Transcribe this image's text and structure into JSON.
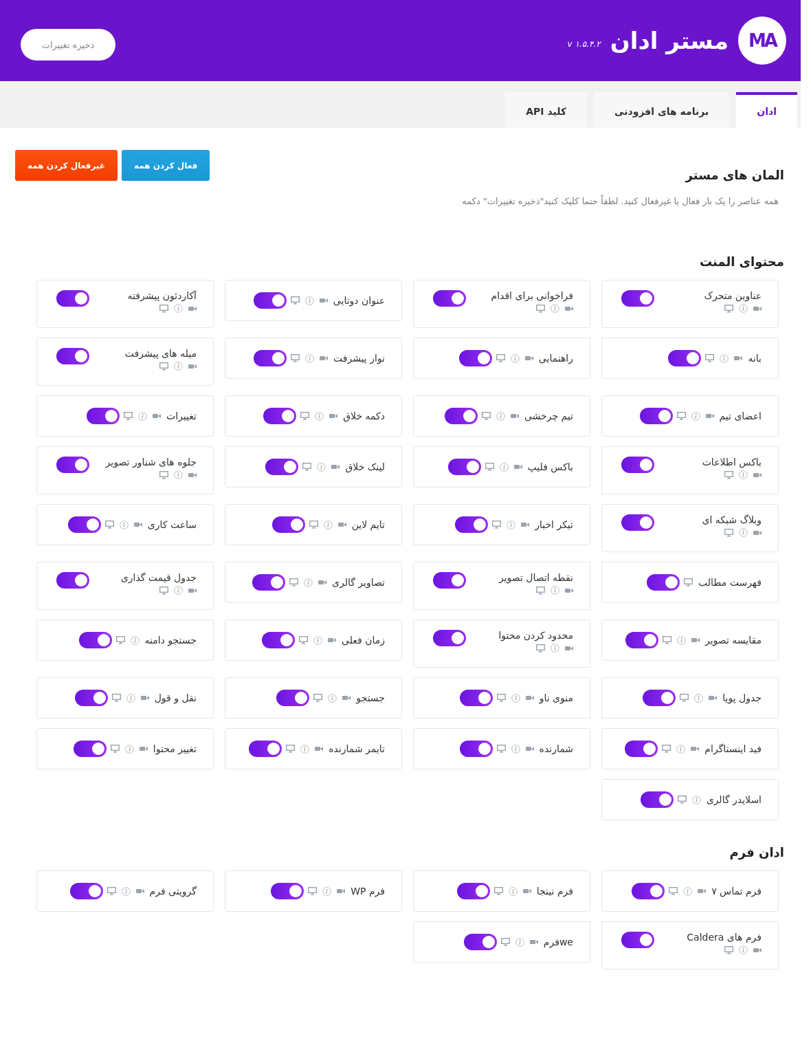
{
  "header": {
    "logo": "MA",
    "title": "مستر ادان",
    "version": "v ۱.۵.۴.۲",
    "save_button": "ذخیره تغییرات"
  },
  "tabs": [
    {
      "label": "ادان",
      "selected": true
    },
    {
      "label": "برنامه های افزودنی",
      "selected": false
    },
    {
      "label": "کلید API",
      "selected": false
    }
  ],
  "intro": {
    "title": "المان های مستر",
    "description": "همه عناصر را یک بار فعال یا غیرفعال کنید. لطفاً حتما کلیک کنید\"ذخیره تغییرات\" دکمه",
    "enable_all": "فعال کردن همه",
    "disable_all": "غیرفعال کردن همه"
  },
  "sections": [
    {
      "title": "محتوای المنت",
      "items": [
        {
          "name": "عناوین متحرک",
          "kind": "stacked",
          "video": true,
          "info": true,
          "desktop": true,
          "on": true
        },
        {
          "name": "فراخوانی برای اقدام",
          "kind": "stacked",
          "video": true,
          "info": true,
          "desktop": true,
          "on": true
        },
        {
          "name": "عنوان دوتایی",
          "kind": "inline",
          "video": true,
          "info": true,
          "desktop": true,
          "on": true
        },
        {
          "name": "آکاردئون پیشرفته",
          "kind": "stacked",
          "video": true,
          "info": true,
          "desktop": true,
          "on": true
        },
        {
          "name": "بانه",
          "kind": "inline",
          "video": true,
          "info": true,
          "desktop": true,
          "on": true
        },
        {
          "name": "راهنمایی",
          "kind": "inline",
          "video": true,
          "info": true,
          "desktop": true,
          "on": true
        },
        {
          "name": "نوار پیشرفت",
          "kind": "inline",
          "video": true,
          "info": true,
          "desktop": true,
          "on": true
        },
        {
          "name": "میله های پیشرفت",
          "kind": "stacked",
          "video": true,
          "info": true,
          "desktop": true,
          "on": true
        },
        {
          "name": "اعضای تیم",
          "kind": "inline",
          "video": true,
          "info": true,
          "desktop": true,
          "on": true
        },
        {
          "name": "تیم چرخشی",
          "kind": "inline",
          "video": true,
          "info": true,
          "desktop": true,
          "on": true
        },
        {
          "name": "دکمه خلاق",
          "kind": "inline",
          "video": true,
          "info": true,
          "desktop": true,
          "on": true
        },
        {
          "name": "تغییرات",
          "kind": "inline",
          "video": true,
          "info": true,
          "desktop": true,
          "on": true
        },
        {
          "name": "باکس اطلاعات",
          "kind": "stacked",
          "video": true,
          "info": true,
          "desktop": true,
          "on": true
        },
        {
          "name": "باکس فلیپ",
          "kind": "inline",
          "video": true,
          "info": true,
          "desktop": true,
          "on": true
        },
        {
          "name": "لینک خلاق",
          "kind": "inline",
          "video": true,
          "info": true,
          "desktop": true,
          "on": true
        },
        {
          "name": "جلوه های شناور تصویر",
          "kind": "stacked",
          "video": true,
          "info": true,
          "desktop": true,
          "on": true
        },
        {
          "name": "وبلاگ شبکه ای",
          "kind": "stacked",
          "video": true,
          "info": true,
          "desktop": true,
          "on": true
        },
        {
          "name": "تیکر اخبار",
          "kind": "inline",
          "video": true,
          "info": true,
          "desktop": true,
          "on": true
        },
        {
          "name": "تایم لاین",
          "kind": "inline",
          "video": true,
          "info": true,
          "desktop": true,
          "on": true
        },
        {
          "name": "ساعت کاری",
          "kind": "inline",
          "video": true,
          "info": true,
          "desktop": true,
          "on": true
        },
        {
          "name": "فهرست مطالب",
          "kind": "inline",
          "video": false,
          "info": false,
          "desktop": true,
          "on": true
        },
        {
          "name": "نقطه اتصال تصویر",
          "kind": "stacked",
          "video": true,
          "info": true,
          "desktop": true,
          "on": true
        },
        {
          "name": "تصاویر گالری",
          "kind": "inline",
          "video": true,
          "info": true,
          "desktop": true,
          "on": true
        },
        {
          "name": "جدول قیمت گذاری",
          "kind": "stacked",
          "video": true,
          "info": true,
          "desktop": true,
          "on": true
        },
        {
          "name": "مقایسه تصویر",
          "kind": "inline",
          "video": true,
          "info": true,
          "desktop": true,
          "on": true
        },
        {
          "name": "محدود کردن محتوا",
          "kind": "stacked",
          "video": true,
          "info": true,
          "desktop": true,
          "on": true
        },
        {
          "name": "زمان فعلی",
          "kind": "inline",
          "video": true,
          "info": true,
          "desktop": true,
          "on": true
        },
        {
          "name": "جستجو دامنه",
          "kind": "inline",
          "video": false,
          "info": true,
          "desktop": true,
          "on": true
        },
        {
          "name": "جدول پویا",
          "kind": "inline",
          "video": true,
          "info": true,
          "desktop": true,
          "on": true
        },
        {
          "name": "منوی ناو",
          "kind": "inline",
          "video": true,
          "info": true,
          "desktop": true,
          "on": true
        },
        {
          "name": "جستجو",
          "kind": "inline",
          "video": true,
          "info": true,
          "desktop": true,
          "on": true
        },
        {
          "name": "نقل و قول",
          "kind": "inline",
          "video": true,
          "info": true,
          "desktop": true,
          "on": true
        },
        {
          "name": "فید اینستاگرام",
          "kind": "inline",
          "video": true,
          "info": true,
          "desktop": true,
          "on": true
        },
        {
          "name": "شمارنده",
          "kind": "inline",
          "video": true,
          "info": true,
          "desktop": true,
          "on": true
        },
        {
          "name": "تایمر شمارنده",
          "kind": "inline",
          "video": true,
          "info": true,
          "desktop": true,
          "on": true
        },
        {
          "name": "تغییر محتوا",
          "kind": "inline",
          "video": true,
          "info": true,
          "desktop": true,
          "on": true
        },
        {
          "name": "اسلایدر گالری",
          "kind": "inline",
          "video": false,
          "info": true,
          "desktop": true,
          "on": true
        }
      ]
    },
    {
      "title": "ادان فرم",
      "items": [
        {
          "name": "فرم تماس ۷",
          "kind": "inline",
          "video": true,
          "info": true,
          "desktop": true,
          "on": true
        },
        {
          "name": "فرم نینجا",
          "kind": "inline",
          "video": true,
          "info": true,
          "desktop": true,
          "on": true
        },
        {
          "name": "فرم WP",
          "kind": "inline",
          "video": true,
          "info": true,
          "desktop": true,
          "on": true
        },
        {
          "name": "گرویتی فرم",
          "kind": "inline",
          "video": true,
          "info": true,
          "desktop": true,
          "on": true
        },
        {
          "name": "فرم های Caldera",
          "kind": "stacked",
          "video": true,
          "info": true,
          "desktop": true,
          "on": true
        },
        {
          "name": "weفرم",
          "kind": "inline",
          "video": true,
          "info": true,
          "desktop": true,
          "on": true
        }
      ]
    }
  ]
}
